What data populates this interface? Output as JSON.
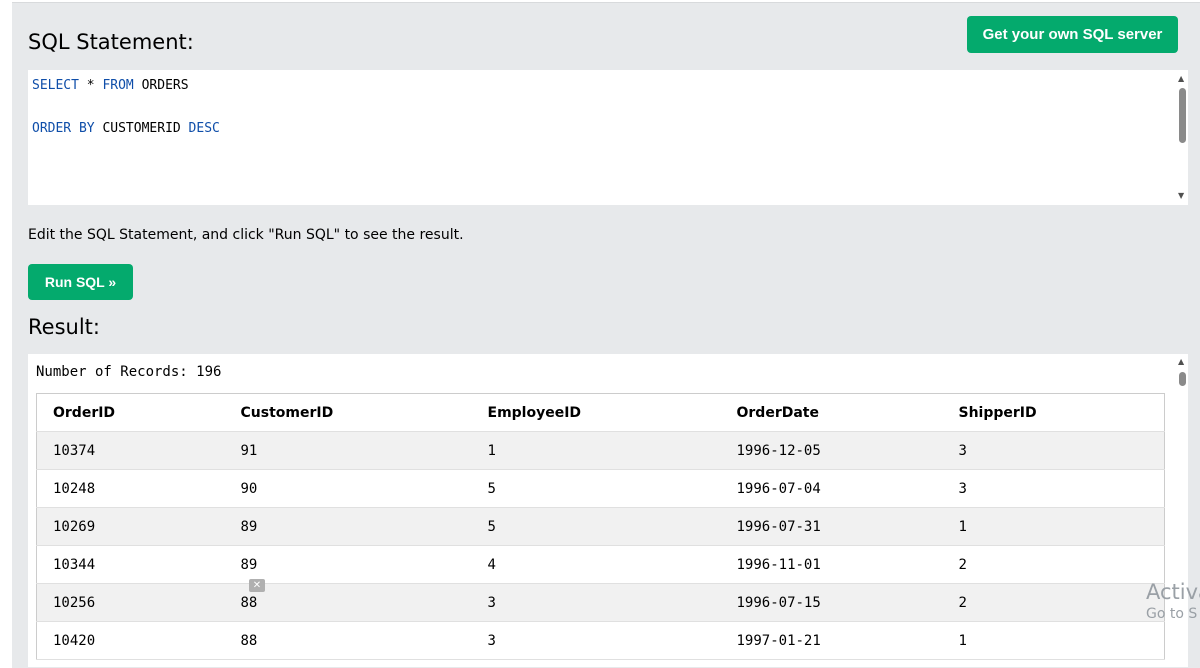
{
  "header": {
    "title": "SQL Statement:",
    "cta_label": "Get your own SQL server"
  },
  "editor": {
    "line1": {
      "k1": "SELECT",
      "t1": " * ",
      "k2": "FROM",
      "t2": " ORDERS"
    },
    "line2": {
      "k1": "ORDER BY",
      "t1": " CUSTOMERID ",
      "k2": "DESC"
    }
  },
  "hint": "Edit the SQL Statement, and click \"Run SQL\" to see the result.",
  "run_label": "Run SQL »",
  "result": {
    "title": "Result:",
    "records_label": "Number of Records: 196",
    "columns": [
      "OrderID",
      "CustomerID",
      "EmployeeID",
      "OrderDate",
      "ShipperID"
    ],
    "rows": [
      [
        "10374",
        "91",
        "1",
        "1996-12-05",
        "3"
      ],
      [
        "10248",
        "90",
        "5",
        "1996-07-04",
        "3"
      ],
      [
        "10269",
        "89",
        "5",
        "1996-07-31",
        "1"
      ],
      [
        "10344",
        "89",
        "4",
        "1996-11-01",
        "2"
      ],
      [
        "10256",
        "88",
        "3",
        "1996-07-15",
        "2"
      ],
      [
        "10420",
        "88",
        "3",
        "1997-01-21",
        "1"
      ]
    ]
  },
  "watermark": {
    "line1": "Activa",
    "line2": "Go to S"
  },
  "icons": {
    "ad_close": "close-icon",
    "scroll_up": "arrow-up-icon",
    "scroll_down": "arrow-down-icon"
  }
}
